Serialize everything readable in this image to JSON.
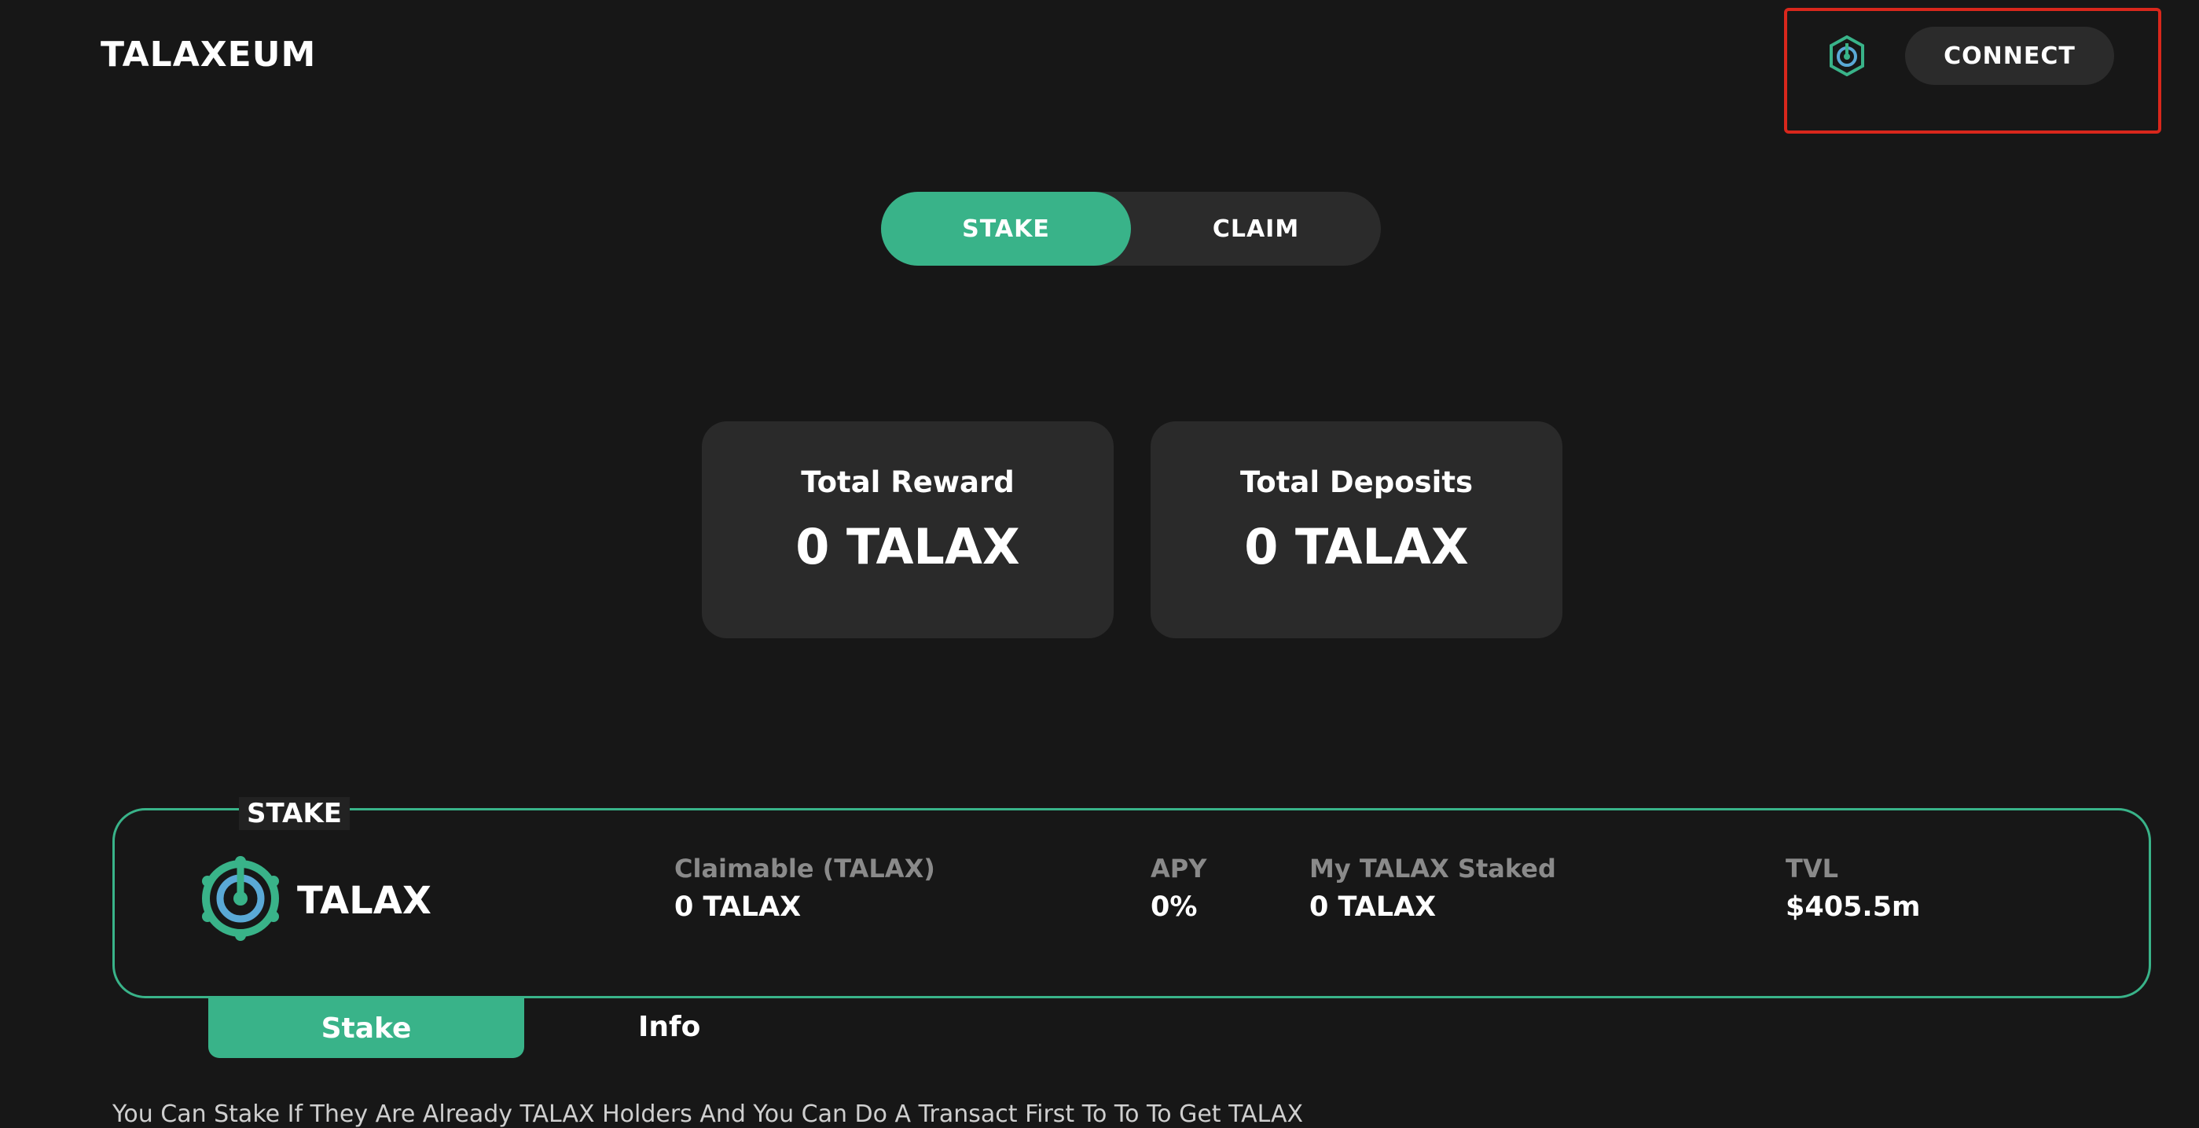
{
  "header": {
    "brand": "TALAXEUM",
    "connect_label": "CONNECT",
    "logo_icon": "talax-logo-icon"
  },
  "mode_toggle": {
    "active": "STAKE",
    "stake_label": "STAKE",
    "claim_label": "CLAIM"
  },
  "stats": {
    "reward_label": "Total Reward",
    "reward_value": "0 TALAX",
    "deposits_label": "Total Deposits",
    "deposits_value": "0 TALAX"
  },
  "pool": {
    "tag": "STAKE",
    "token_name": "TALAX",
    "token_icon": "talax-token-icon",
    "claimable_label": "Claimable (TALAX)",
    "claimable_value": "0 TALAX",
    "apy_label": "APY",
    "apy_value": "0%",
    "staked_label": "My TALAX Staked",
    "staked_value": "0 TALAX",
    "tvl_label": "TVL",
    "tvl_value": "$405.5m"
  },
  "sub_tabs": {
    "active": "Stake",
    "stake_label": "Stake",
    "info_label": "Info"
  },
  "footer_text": "You Can Stake If They Are Already TALAX Holders And You Can Do A Transact First To To To Get TALAX",
  "colors": {
    "background": "#171717",
    "accent": "#39b389",
    "card": "#2a2a2a",
    "highlight": "#d9271c"
  }
}
